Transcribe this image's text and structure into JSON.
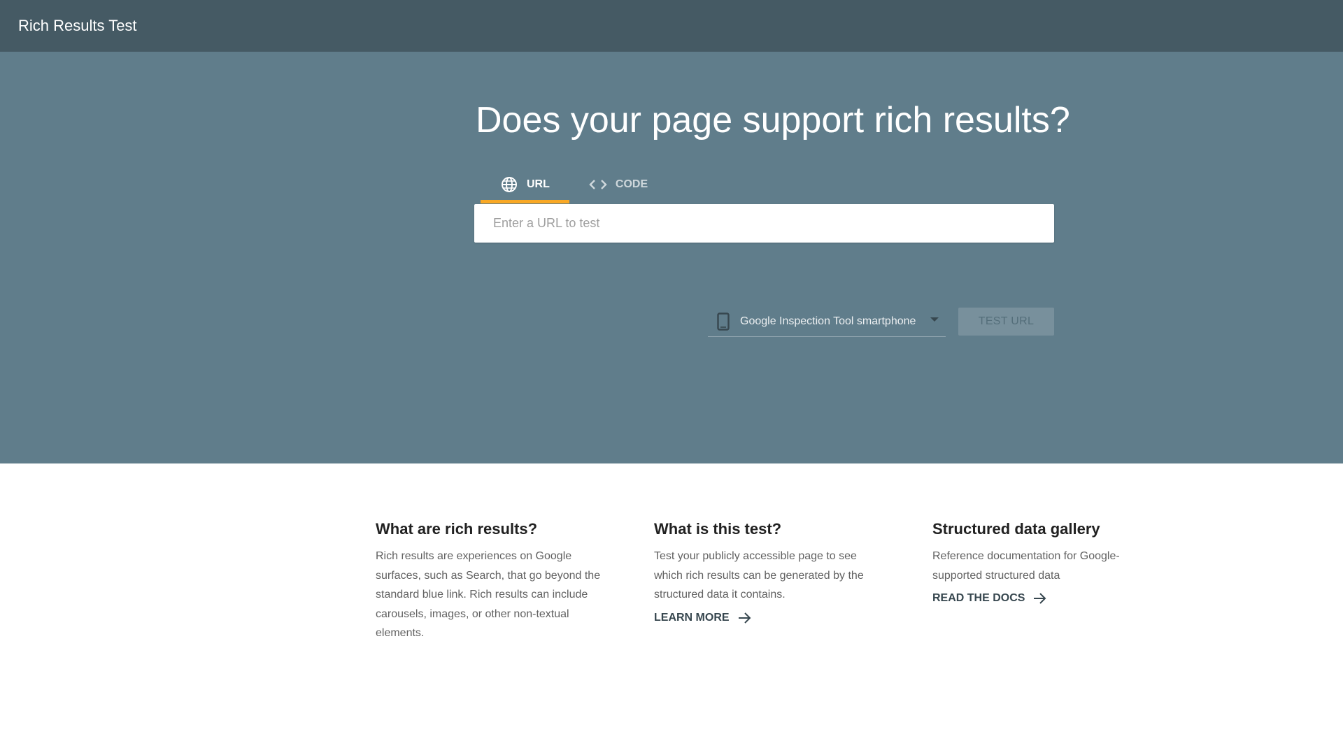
{
  "header": {
    "app_title": "Rich Results Test"
  },
  "hero": {
    "headline": "Does your page support rich results?",
    "tabs": [
      {
        "label": "URL",
        "icon": "globe-icon",
        "active": true
      },
      {
        "label": "CODE",
        "icon": "code-icon",
        "active": false
      }
    ],
    "url_input": {
      "placeholder": "Enter a URL to test",
      "value": ""
    },
    "device_select": {
      "icon": "smartphone-icon",
      "selected": "Google Inspection Tool smartphone"
    },
    "test_button_label": "TEST URL"
  },
  "info": [
    {
      "title": "What are rich results?",
      "body": "Rich results are experiences on Google surfaces, such as Search, that go beyond the standard blue link. Rich results can include carousels, images, or other non-textual elements.",
      "link": ""
    },
    {
      "title": "What is this test?",
      "body": "Test your publicly accessible page to see which rich results can be generated by the structured data it contains.",
      "link": "LEARN MORE"
    },
    {
      "title": "Structured data gallery",
      "body": "Reference documentation for Google-supported structured data",
      "link": "READ THE DOCS"
    }
  ],
  "colors": {
    "topbar": "#455a64",
    "hero": "#607d8b",
    "tab_indicator": "#f9a825"
  }
}
